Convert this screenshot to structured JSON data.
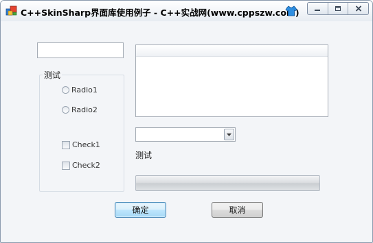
{
  "window": {
    "title": "C++SkinSharp界面库使用例子 - C++实战网(www.cppszw.com)",
    "system_buttons": [
      "minimize",
      "restore",
      "close"
    ]
  },
  "textbox": {
    "value": ""
  },
  "group": {
    "title": "测试",
    "radios": [
      {
        "label": "Radio1",
        "checked": false
      },
      {
        "label": "Radio2",
        "checked": false
      }
    ],
    "checkboxes": [
      {
        "label": "Check1",
        "checked": false
      },
      {
        "label": "Check2",
        "checked": false
      }
    ]
  },
  "list": {
    "items": []
  },
  "combo": {
    "value": ""
  },
  "static_label": "测试",
  "progress": {
    "value": 0
  },
  "buttons": {
    "ok_label": "确定",
    "cancel_label": "取消"
  },
  "colors": {
    "ok_border": "#3c7fb1",
    "window_bg": "#f3f5f8"
  },
  "icons": {
    "app": "app-icon",
    "skin": "skin-shirt-icon"
  }
}
